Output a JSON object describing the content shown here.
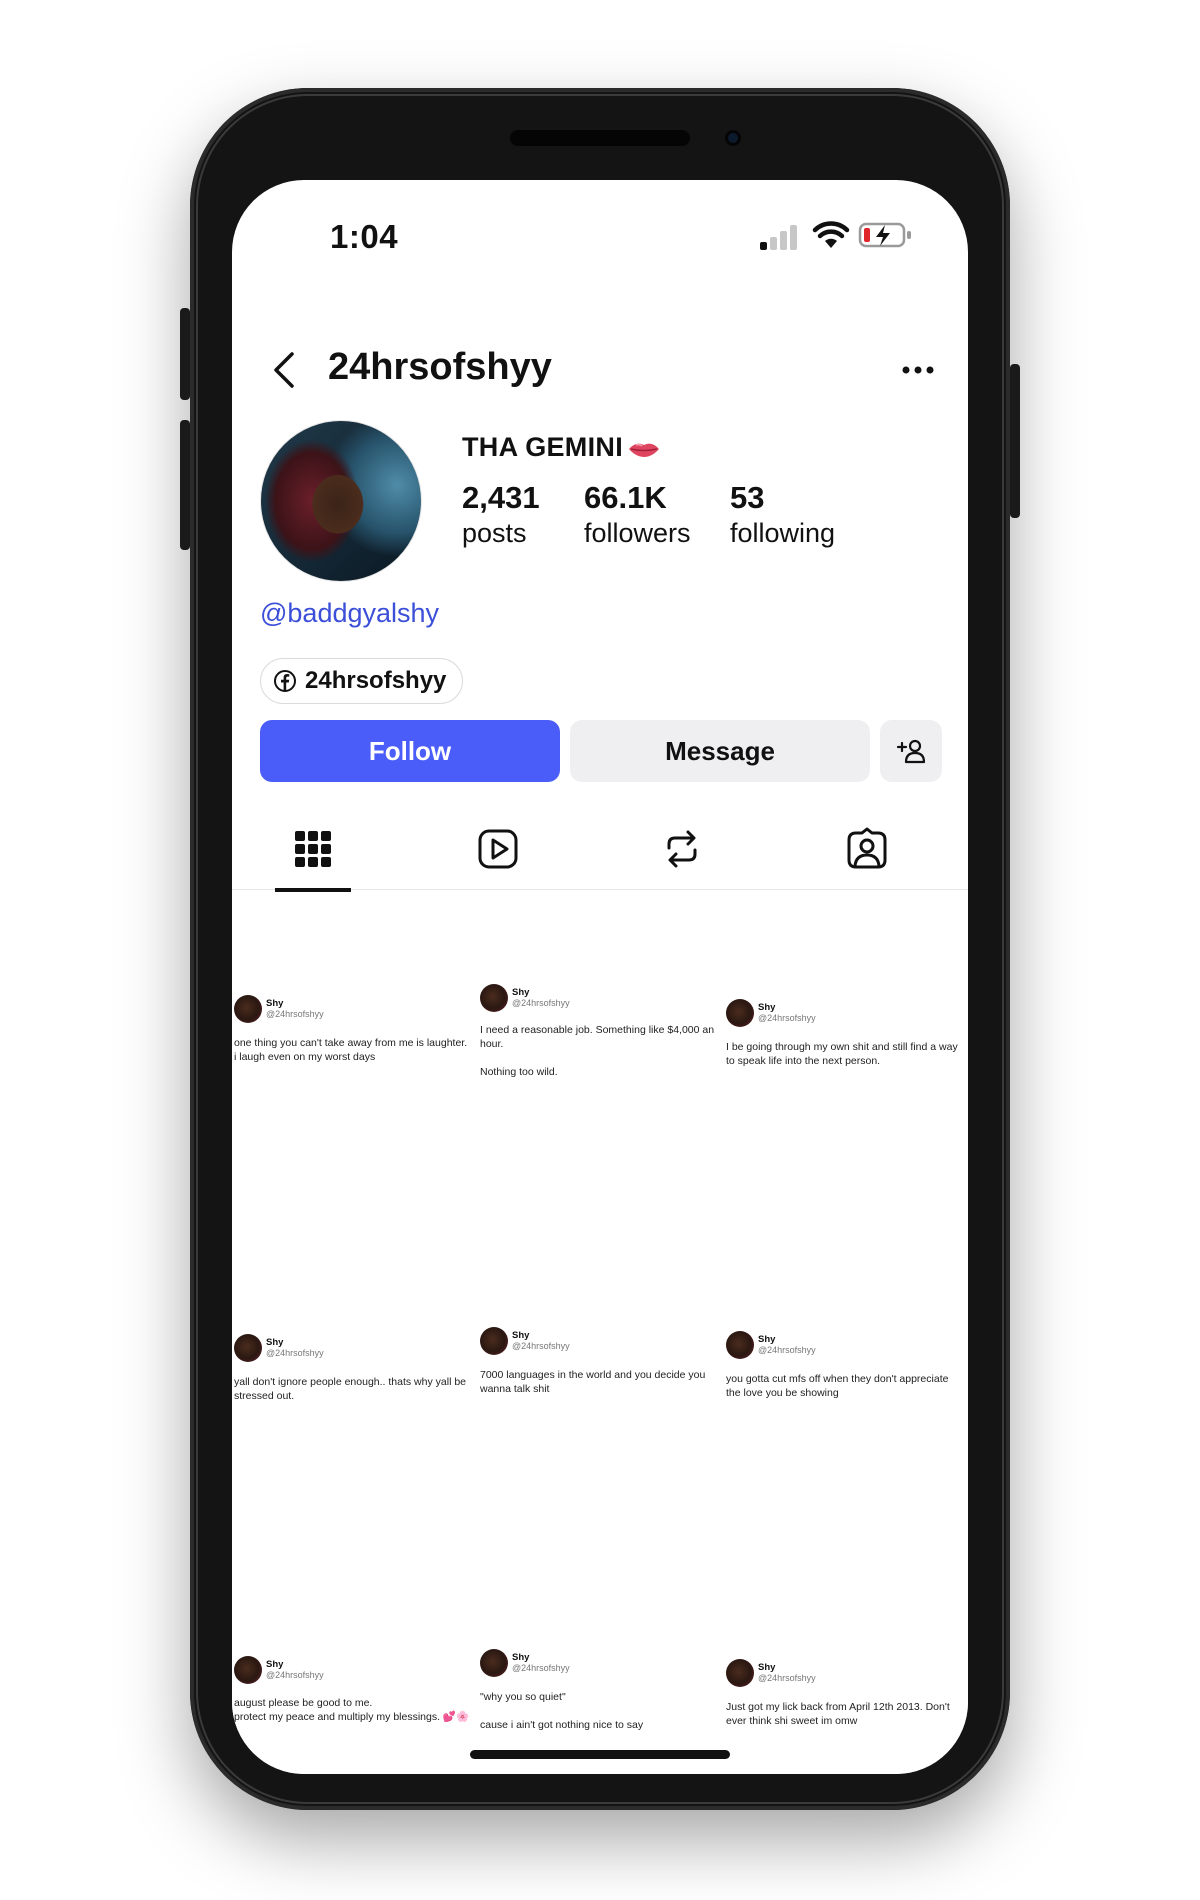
{
  "status_bar": {
    "time": "1:04"
  },
  "header": {
    "username": "24hrsofshyy"
  },
  "profile": {
    "display_name": "THA GEMINI",
    "stats": [
      {
        "value": "2,431",
        "label": "posts"
      },
      {
        "value": "66.1K",
        "label": "followers"
      },
      {
        "value": "53",
        "label": "following"
      }
    ],
    "link": "@baddgyalshy",
    "facebook_link": "24hrsofshyy"
  },
  "actions": {
    "follow_label": "Follow",
    "message_label": "Message"
  },
  "tabs": [
    "grid-tab",
    "reels-tab",
    "reposts-tab",
    "tagged-tab"
  ],
  "colors": {
    "follow_button": "#4a5df9",
    "link": "#3b4fd8",
    "message_button": "#efeff2"
  },
  "posts": [
    {
      "name": "Shy",
      "handle": "@24hrsofshyy",
      "text": "one thing you can't take away from me is laughter. i laugh even on my worst days"
    },
    {
      "name": "Shy",
      "handle": "@24hrsofshyy",
      "text": "I need a reasonable job. Something like $4,000 an hour.\n\nNothing too wild."
    },
    {
      "name": "Shy",
      "handle": "@24hrsofshyy",
      "text": "I be going through my own shit and still find a way to speak life into the next person."
    },
    {
      "name": "Shy",
      "handle": "@24hrsofshyy",
      "text": "yall don't ignore people enough.. thats why yall be stressed out."
    },
    {
      "name": "Shy",
      "handle": "@24hrsofshyy",
      "text": "7000 languages in the world and you decide you wanna talk shit"
    },
    {
      "name": "Shy",
      "handle": "@24hrsofshyy",
      "text": "you gotta cut mfs off when they don't appreciate the love you be showing"
    },
    {
      "name": "Shy",
      "handle": "@24hrsofshyy",
      "text": "august please be good to me.\nprotect my peace and multiply my blessings. 💕🌸"
    },
    {
      "name": "Shy",
      "handle": "@24hrsofshyy",
      "text": "\"why you so quiet\"\n\ncause i ain't got nothing nice to say"
    },
    {
      "name": "Shy",
      "handle": "@24hrsofshyy",
      "text": "Just got my lick back from April 12th 2013. Don't ever think shi sweet im omw"
    }
  ]
}
